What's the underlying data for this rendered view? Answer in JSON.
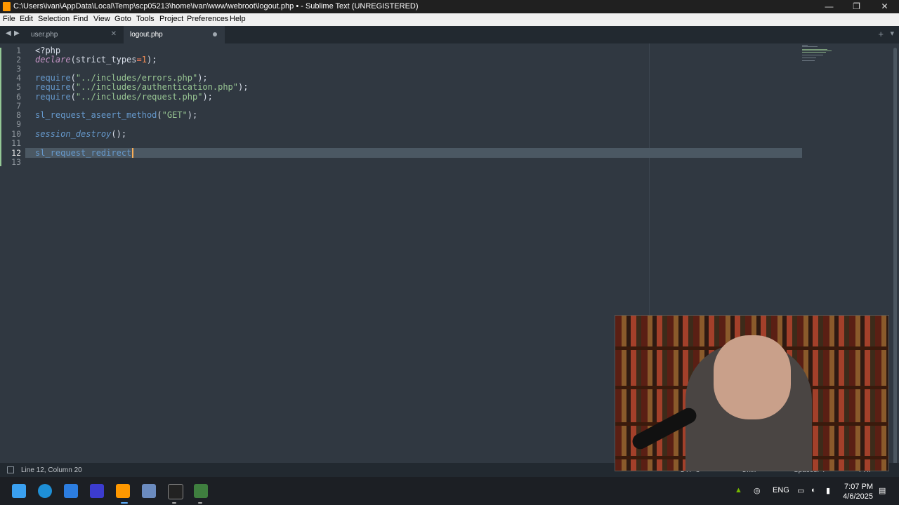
{
  "window": {
    "title": "C:\\Users\\ivan\\AppData\\Local\\Temp\\scp05213\\home\\ivan\\www\\webroot\\logout.php • - Sublime Text (UNREGISTERED)",
    "minimize": "—",
    "maximize": "❐",
    "close": "✕"
  },
  "menu": [
    "File",
    "Edit",
    "Selection",
    "Find",
    "View",
    "Goto",
    "Tools",
    "Project",
    "Preferences",
    "Help"
  ],
  "tabs": {
    "nav_prev": "◀",
    "nav_next": "▶",
    "items": [
      {
        "label": "user.php",
        "close": "✕"
      },
      {
        "label": "logout.php",
        "active": true,
        "modified": true
      }
    ],
    "new_tab": "+",
    "more": "▾"
  },
  "editor": {
    "line_numbers": [
      "1",
      "2",
      "3",
      "4",
      "5",
      "6",
      "7",
      "8",
      "9",
      "10",
      "11",
      "12",
      "13"
    ],
    "current_line": 12,
    "lines": {
      "l1": "<?php",
      "l2_fn": "declare",
      "l2_a": "(strict_types",
      "l2_eq": "=",
      "l2_num": "1",
      "l2_b": ");",
      "l4_fn": "require",
      "l4_str": "\"../includes/errors.php\"",
      "l5_fn": "require",
      "l5_str": "\"../includes/authentication.php\"",
      "l6_fn": "require",
      "l6_str": "\"../includes/request.php\"",
      "l8_fn": "sl_request_aseert_method",
      "l8_str": "\"GET\"",
      "l10_fn": "session_destroy",
      "l10_rest": "();",
      "l12_text": "sl_request_redirect",
      "open_paren": "(",
      "close_stmt": ");"
    }
  },
  "status": {
    "position": "Line 12, Column 20",
    "encoding": "UTF-8",
    "line_endings": "Unix",
    "indentation": "Spaces: 4",
    "syntax": "PHP"
  },
  "taskbar": {
    "language": "ENG",
    "time": "7:07 PM",
    "date": "4/6/2025",
    "icons": [
      "windows-start",
      "edge",
      "xcode-like",
      "visual-studio",
      "sublime-text",
      "calculator",
      "terminal",
      "file-transfer"
    ]
  },
  "colors": {
    "editor_bg": "#303841",
    "string": "#99c794",
    "function": "#6699cc",
    "keyword": "#c695c6",
    "number": "#f99157",
    "caret": "#f9ae58"
  }
}
